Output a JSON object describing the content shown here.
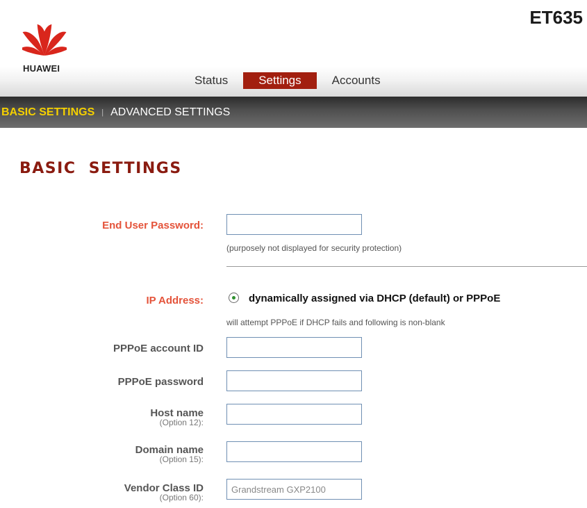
{
  "header": {
    "model": "ET635",
    "brand": "HUAWEI",
    "brand_color": "#d9261c"
  },
  "topnav": {
    "tabs": [
      {
        "label": "Status",
        "active": false
      },
      {
        "label": "Settings",
        "active": true
      },
      {
        "label": "Accounts",
        "active": false
      }
    ],
    "active_color": "#a21f0f"
  },
  "subnav": {
    "items": [
      {
        "label": "BASIC SETTINGS",
        "active": true
      },
      {
        "label": "ADVANCED SETTINGS",
        "active": false
      }
    ],
    "separator": "|",
    "active_color": "#f5d000"
  },
  "page": {
    "title": "BASIC  SETTINGS"
  },
  "form": {
    "end_user_password": {
      "label": "End User Password:",
      "value": "",
      "note": "(purposely not displayed for security protection)"
    },
    "ip_address": {
      "label": "IP Address:",
      "option_label": "dynamically assigned via DHCP (default) or PPPoE",
      "selected": true,
      "note": "will attempt PPPoE if DHCP fails and following is non-blank"
    },
    "pppoe_account_id": {
      "label": "PPPoE account ID",
      "value": ""
    },
    "pppoe_password": {
      "label": "PPPoE password",
      "value": ""
    },
    "host_name": {
      "label": "Host name",
      "sub": "(Option 12):",
      "value": ""
    },
    "domain_name": {
      "label": "Domain name",
      "sub": "(Option 15):",
      "value": ""
    },
    "vendor_class_id": {
      "label": "Vendor Class ID",
      "sub": "(Option 60):",
      "value": "Grandstream GXP2100"
    }
  }
}
